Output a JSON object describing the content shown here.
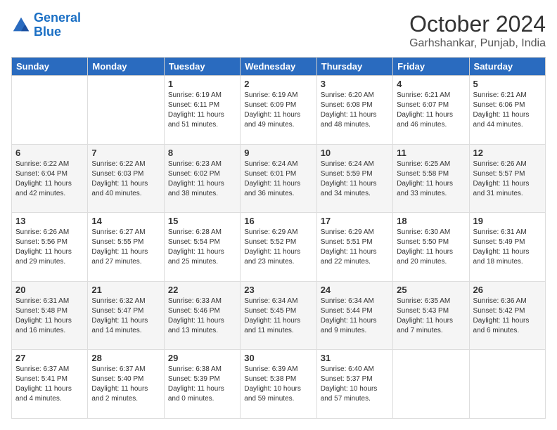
{
  "logo": {
    "line1": "General",
    "line2": "Blue"
  },
  "header": {
    "month": "October 2024",
    "location": "Garhshankar, Punjab, India"
  },
  "weekdays": [
    "Sunday",
    "Monday",
    "Tuesday",
    "Wednesday",
    "Thursday",
    "Friday",
    "Saturday"
  ],
  "weeks": [
    [
      {
        "day": "",
        "info": ""
      },
      {
        "day": "",
        "info": ""
      },
      {
        "day": "1",
        "info": "Sunrise: 6:19 AM\nSunset: 6:11 PM\nDaylight: 11 hours and 51 minutes."
      },
      {
        "day": "2",
        "info": "Sunrise: 6:19 AM\nSunset: 6:09 PM\nDaylight: 11 hours and 49 minutes."
      },
      {
        "day": "3",
        "info": "Sunrise: 6:20 AM\nSunset: 6:08 PM\nDaylight: 11 hours and 48 minutes."
      },
      {
        "day": "4",
        "info": "Sunrise: 6:21 AM\nSunset: 6:07 PM\nDaylight: 11 hours and 46 minutes."
      },
      {
        "day": "5",
        "info": "Sunrise: 6:21 AM\nSunset: 6:06 PM\nDaylight: 11 hours and 44 minutes."
      }
    ],
    [
      {
        "day": "6",
        "info": "Sunrise: 6:22 AM\nSunset: 6:04 PM\nDaylight: 11 hours and 42 minutes."
      },
      {
        "day": "7",
        "info": "Sunrise: 6:22 AM\nSunset: 6:03 PM\nDaylight: 11 hours and 40 minutes."
      },
      {
        "day": "8",
        "info": "Sunrise: 6:23 AM\nSunset: 6:02 PM\nDaylight: 11 hours and 38 minutes."
      },
      {
        "day": "9",
        "info": "Sunrise: 6:24 AM\nSunset: 6:01 PM\nDaylight: 11 hours and 36 minutes."
      },
      {
        "day": "10",
        "info": "Sunrise: 6:24 AM\nSunset: 5:59 PM\nDaylight: 11 hours and 34 minutes."
      },
      {
        "day": "11",
        "info": "Sunrise: 6:25 AM\nSunset: 5:58 PM\nDaylight: 11 hours and 33 minutes."
      },
      {
        "day": "12",
        "info": "Sunrise: 6:26 AM\nSunset: 5:57 PM\nDaylight: 11 hours and 31 minutes."
      }
    ],
    [
      {
        "day": "13",
        "info": "Sunrise: 6:26 AM\nSunset: 5:56 PM\nDaylight: 11 hours and 29 minutes."
      },
      {
        "day": "14",
        "info": "Sunrise: 6:27 AM\nSunset: 5:55 PM\nDaylight: 11 hours and 27 minutes."
      },
      {
        "day": "15",
        "info": "Sunrise: 6:28 AM\nSunset: 5:54 PM\nDaylight: 11 hours and 25 minutes."
      },
      {
        "day": "16",
        "info": "Sunrise: 6:29 AM\nSunset: 5:52 PM\nDaylight: 11 hours and 23 minutes."
      },
      {
        "day": "17",
        "info": "Sunrise: 6:29 AM\nSunset: 5:51 PM\nDaylight: 11 hours and 22 minutes."
      },
      {
        "day": "18",
        "info": "Sunrise: 6:30 AM\nSunset: 5:50 PM\nDaylight: 11 hours and 20 minutes."
      },
      {
        "day": "19",
        "info": "Sunrise: 6:31 AM\nSunset: 5:49 PM\nDaylight: 11 hours and 18 minutes."
      }
    ],
    [
      {
        "day": "20",
        "info": "Sunrise: 6:31 AM\nSunset: 5:48 PM\nDaylight: 11 hours and 16 minutes."
      },
      {
        "day": "21",
        "info": "Sunrise: 6:32 AM\nSunset: 5:47 PM\nDaylight: 11 hours and 14 minutes."
      },
      {
        "day": "22",
        "info": "Sunrise: 6:33 AM\nSunset: 5:46 PM\nDaylight: 11 hours and 13 minutes."
      },
      {
        "day": "23",
        "info": "Sunrise: 6:34 AM\nSunset: 5:45 PM\nDaylight: 11 hours and 11 minutes."
      },
      {
        "day": "24",
        "info": "Sunrise: 6:34 AM\nSunset: 5:44 PM\nDaylight: 11 hours and 9 minutes."
      },
      {
        "day": "25",
        "info": "Sunrise: 6:35 AM\nSunset: 5:43 PM\nDaylight: 11 hours and 7 minutes."
      },
      {
        "day": "26",
        "info": "Sunrise: 6:36 AM\nSunset: 5:42 PM\nDaylight: 11 hours and 6 minutes."
      }
    ],
    [
      {
        "day": "27",
        "info": "Sunrise: 6:37 AM\nSunset: 5:41 PM\nDaylight: 11 hours and 4 minutes."
      },
      {
        "day": "28",
        "info": "Sunrise: 6:37 AM\nSunset: 5:40 PM\nDaylight: 11 hours and 2 minutes."
      },
      {
        "day": "29",
        "info": "Sunrise: 6:38 AM\nSunset: 5:39 PM\nDaylight: 11 hours and 0 minutes."
      },
      {
        "day": "30",
        "info": "Sunrise: 6:39 AM\nSunset: 5:38 PM\nDaylight: 10 hours and 59 minutes."
      },
      {
        "day": "31",
        "info": "Sunrise: 6:40 AM\nSunset: 5:37 PM\nDaylight: 10 hours and 57 minutes."
      },
      {
        "day": "",
        "info": ""
      },
      {
        "day": "",
        "info": ""
      }
    ]
  ]
}
